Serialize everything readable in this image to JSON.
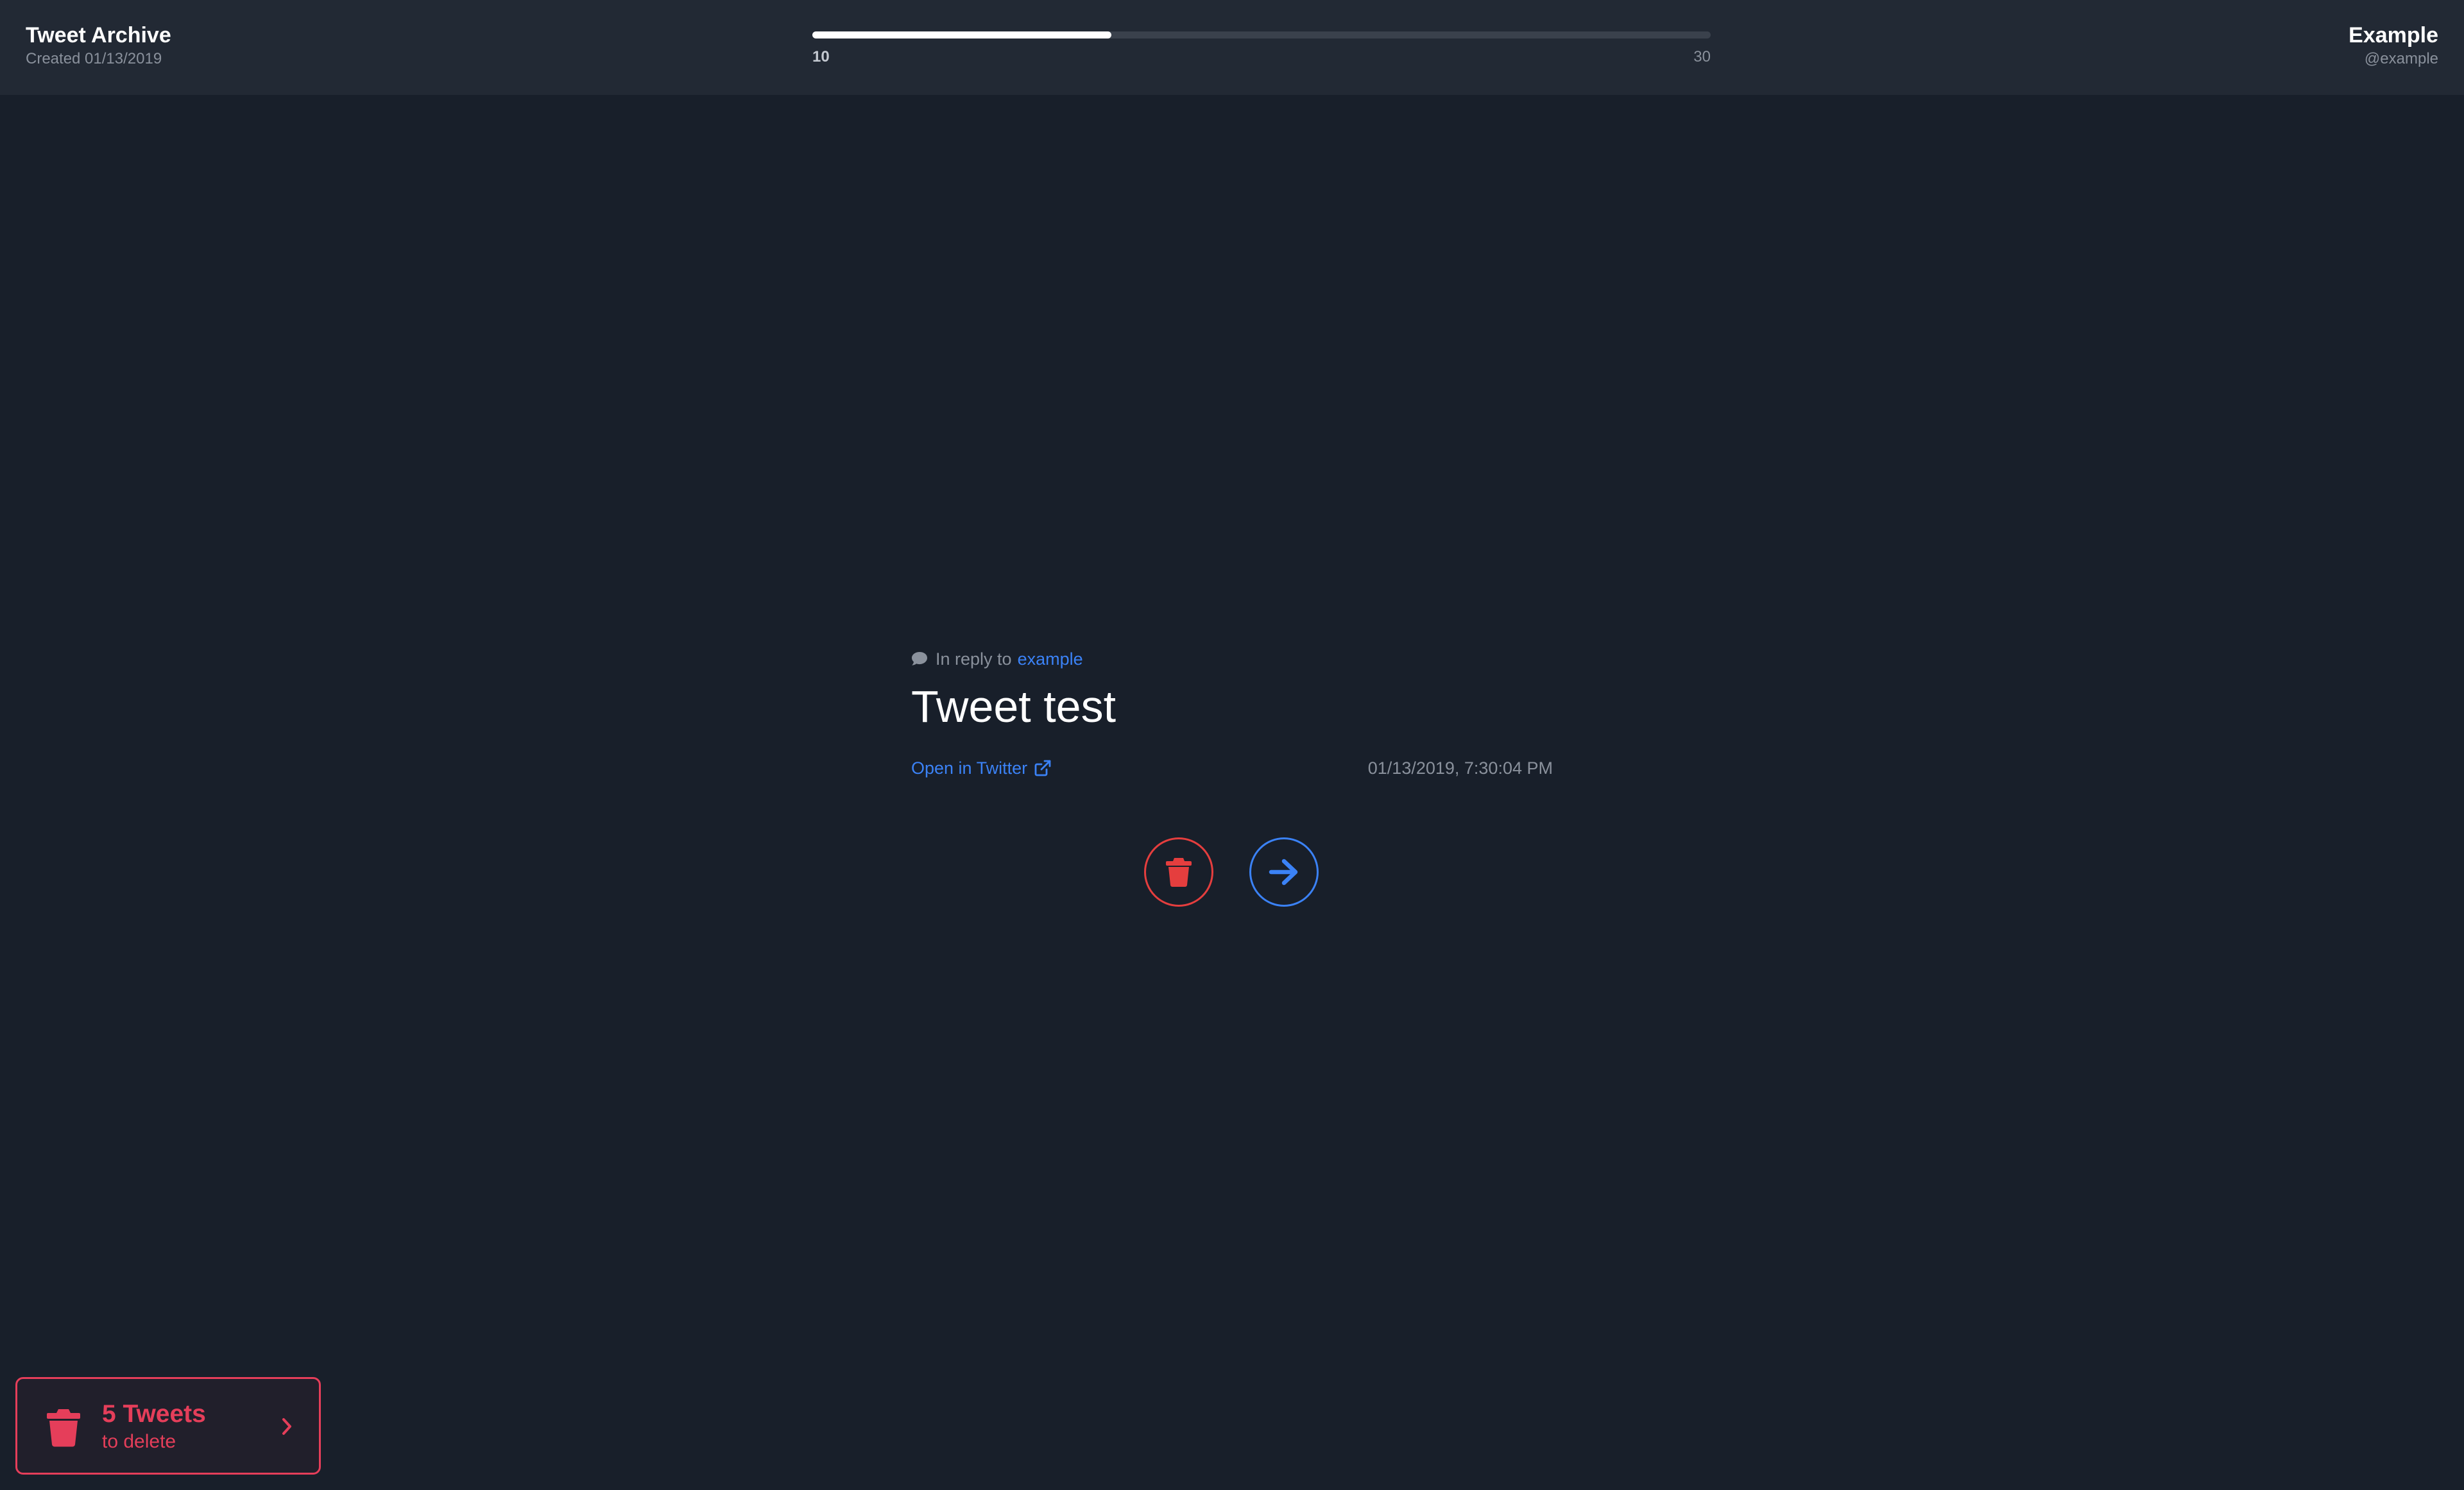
{
  "header": {
    "title": "Tweet Archive",
    "created": "Created 01/13/2019",
    "user_name": "Example",
    "user_handle": "@example"
  },
  "progress": {
    "start_label": "10",
    "end_label": "30",
    "fraction": 0.333
  },
  "tweet": {
    "reply_prefix": "In reply to",
    "reply_to": "example",
    "text": "Tweet test",
    "open_link_label": "Open in Twitter",
    "timestamp": "01/13/2019, 7:30:04 PM"
  },
  "actions": {
    "delete_icon": "trash-icon",
    "next_icon": "arrow-right-icon"
  },
  "delete_panel": {
    "count_label": "5 Tweets",
    "sub_label": "to delete"
  },
  "colors": {
    "background": "#181f2a",
    "header": "#222934",
    "accent_blue": "#3b82f6",
    "danger_red": "#e53e3e",
    "muted_text": "#8a919c"
  }
}
